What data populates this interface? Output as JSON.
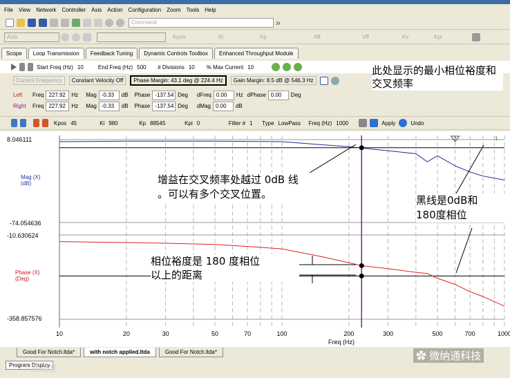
{
  "menu": [
    "File",
    "View",
    "Network",
    "Controller",
    "Axis",
    "Action",
    "Configuration",
    "Zoom",
    "Tools",
    "Help"
  ],
  "toolbar1": {
    "command_placeholder": "Command"
  },
  "toolbar2": {
    "axis_label": "Axis",
    "kpos": "Kpos",
    "ki": "Ki",
    "kp": "Kp",
    "aff": "Aff",
    "vff": "Vff",
    "kv": "Kv",
    "kpi": "Kpi"
  },
  "tabs": [
    "Scope",
    "Loop Transmission",
    "Feedback Tuning",
    "Dynamic Controls Toolbox",
    "Enhanced Throughput Module"
  ],
  "controls": {
    "start_freq_label": "Start Freq (Hz)",
    "start_freq": "10",
    "end_freq_label": "End Freq (Hz)",
    "end_freq": "500",
    "divisions_label": "# Divisions",
    "divisions": "10",
    "max_current_label": "% Max Current",
    "max_current": "10"
  },
  "status": {
    "current_frequency": "Current Frequency",
    "constant_velocity": "Constant Velocity Off",
    "phase_margin": "Phase Margin: 43.1 deg @ 224.4 Hz",
    "gain_margin": "Gain Margin: 8.5 dB @ 546.3 Hz"
  },
  "cursor_left": {
    "label": "Left",
    "freq_label": "Freq",
    "freq": "227.92",
    "freq_unit": "Hz",
    "mag_label": "Mag",
    "mag": "-0.33",
    "mag_unit": "dB",
    "phase_label": "Phase",
    "phase": "-137.54",
    "phase_unit": "Deg",
    "dfreq_label": "dFreq",
    "dfreq": "0.00",
    "dfreq_unit": "Hz",
    "dphase_label": "dPhase",
    "dphase": "0.00",
    "dphase_unit": "Deg"
  },
  "cursor_right": {
    "label": "Right",
    "freq_label": "Freq",
    "freq": "227.92",
    "freq_unit": "Hz",
    "mag_label": "Mag",
    "mag": "-0.33",
    "mag_unit": "dB",
    "phase_label": "Phase",
    "phase": "-137.54",
    "phase_unit": "Deg",
    "dmag_label": "dMag",
    "dmag": "0.00",
    "dmag_unit": "dB"
  },
  "filter_bar": {
    "kpos_label": "Kpos",
    "kpos": "45",
    "ki_label": "Ki",
    "ki": "980",
    "kp_label": "Kp",
    "kp": "88545",
    "kpi_label": "Kpi",
    "kpi": "0",
    "filter_label": "Filter #",
    "filter": "1",
    "type_label": "Type",
    "type": "LowPass",
    "freq_label": "Freq (Hz)",
    "freq": "1000",
    "apply": "Apply",
    "undo": "Undo"
  },
  "plot": {
    "mag_label": "Mag (X)",
    "mag_unit": "(dB)",
    "mag_top": "8.046111",
    "mag_bottom": "-74.054636",
    "phase_label": "Phase (X)",
    "phase_unit": "(Deg)",
    "phase_top": "-10.630624",
    "phase_bottom": "-358.857576",
    "xlabel": "Freq (Hz)",
    "xticks": [
      "10",
      "20",
      "30",
      "50",
      "70",
      "100",
      "200",
      "300",
      "500",
      "700",
      "1000"
    ],
    "marker2": "2",
    "marker1": "1"
  },
  "chart_data": {
    "type": "line",
    "xlabel": "Freq (Hz)",
    "xscale": "log",
    "xlim": [
      10,
      1000
    ],
    "series": [
      {
        "name": "Mag (X)",
        "unit": "dB",
        "ylim": [
          -74.054636,
          8.046111
        ],
        "x": [
          10,
          20,
          30,
          50,
          70,
          100,
          150,
          200,
          228,
          300,
          400,
          450,
          500,
          600,
          700,
          800,
          1000
        ],
        "y": [
          6,
          6.5,
          6.5,
          6.5,
          6.3,
          6,
          3,
          1,
          -0.33,
          -3,
          -6,
          -14,
          -8,
          -18,
          -24,
          -28,
          -32
        ]
      },
      {
        "name": "Phase (X)",
        "unit": "Deg",
        "ylim": [
          -358.857576,
          -10.630624
        ],
        "x": [
          10,
          20,
          30,
          50,
          70,
          100,
          150,
          200,
          228,
          300,
          400,
          450,
          500,
          600,
          700,
          800,
          1000
        ],
        "y": [
          -38,
          -42,
          -45,
          -50,
          -58,
          -68,
          -100,
          -125,
          -137.54,
          -150,
          -165,
          -170,
          -190,
          -215,
          -245,
          -265,
          -305
        ]
      }
    ]
  },
  "bottom_tabs": [
    "Good For Notch.ltda*",
    "with notch applied.ltda",
    "Good For Notch.ltda*"
  ],
  "program_display": "Program Display",
  "annotations": {
    "top_right": "此处显示的最小相位裕度和交叉频率",
    "crossover": "增益在交叉频率处越过 0dB 线\n。可以有多个交叉位置。",
    "black_line": "黑线是0dB和\n180度相位",
    "phase_margin": "相位裕度是 180 度相位\n以上的距离"
  },
  "watermark": "微纳通科技",
  "watermark_left": "八极维度"
}
